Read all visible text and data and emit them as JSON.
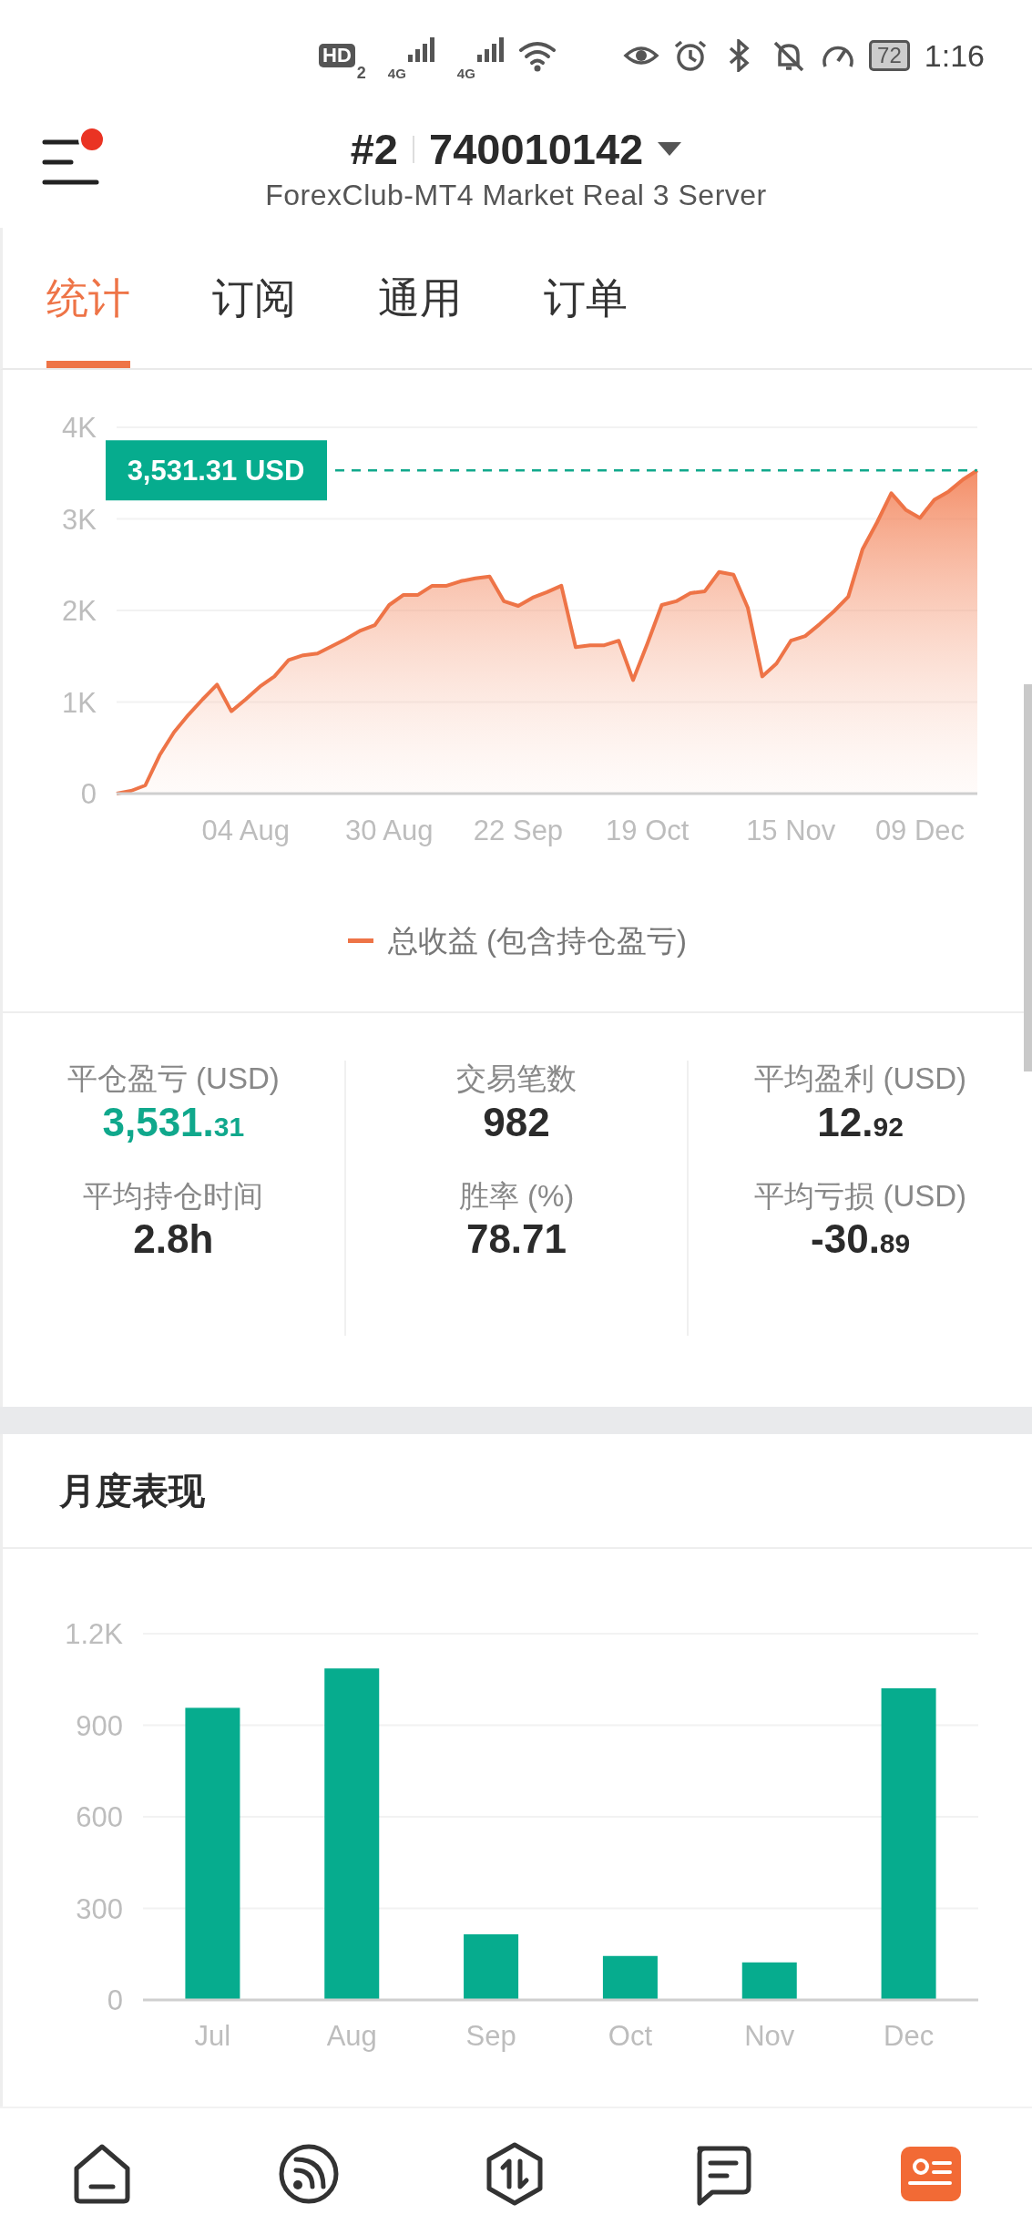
{
  "status_bar": {
    "hd": "HD",
    "sim": "2",
    "networks": [
      "4G",
      "4G"
    ],
    "battery": "72",
    "time": "1:16"
  },
  "header": {
    "account_index": "#2",
    "account_number": "740010142",
    "server": "ForexClub-MT4 Market Real 3 Server",
    "has_notification": true
  },
  "tabs": [
    {
      "label": "统计",
      "selected": true
    },
    {
      "label": "订阅",
      "selected": false
    },
    {
      "label": "通用",
      "selected": false
    },
    {
      "label": "订单",
      "selected": false
    }
  ],
  "equity_chart": {
    "current_value_label": "3,531.31 USD",
    "chart_data": {
      "type": "area",
      "grid": true,
      "categories": [
        null,
        null,
        null,
        null,
        null,
        null,
        null,
        null,
        null,
        "04 Aug",
        null,
        null,
        null,
        null,
        null,
        null,
        null,
        null,
        null,
        "30 Aug",
        null,
        null,
        null,
        null,
        null,
        null,
        null,
        null,
        "22 Sep",
        null,
        null,
        null,
        null,
        null,
        null,
        null,
        null,
        "19 Oct",
        null,
        null,
        null,
        null,
        null,
        null,
        null,
        null,
        null,
        "15 Nov",
        null,
        null,
        null,
        null,
        null,
        null,
        null,
        null,
        "09 Dec",
        null,
        null,
        null,
        null
      ],
      "series": [
        {
          "name": "总收益 (包含持仓盈亏)",
          "color": "#ee7447",
          "values": [
            0,
            30,
            90,
            420,
            670,
            860,
            1030,
            1190,
            900,
            1030,
            1170,
            1280,
            1460,
            1510,
            1530,
            1610,
            1690,
            1780,
            1840,
            2060,
            2170,
            2170,
            2270,
            2270,
            2320,
            2350,
            2370,
            2100,
            2050,
            2140,
            2200,
            2270,
            1600,
            1620,
            1620,
            1670,
            1240,
            1640,
            2060,
            2100,
            2190,
            2210,
            2420,
            2390,
            2030,
            1280,
            1420,
            1670,
            1720,
            1850,
            1990,
            2150,
            2670,
            2960,
            3280,
            3100,
            3010,
            3210,
            3300,
            3430,
            3530
          ]
        }
      ],
      "ylim": [
        0,
        4000
      ],
      "yticks": [
        {
          "value": 0,
          "label": "0"
        },
        {
          "value": 1000,
          "label": "1K"
        },
        {
          "value": 2000,
          "label": "2K"
        },
        {
          "value": 3000,
          "label": "3K"
        },
        {
          "value": 4000,
          "label": "4K"
        }
      ]
    }
  },
  "stats": [
    {
      "label": "平仓盈亏 (USD)",
      "value": "3,531.",
      "decimals": "31",
      "kind": "positive"
    },
    {
      "label": "交易笔数",
      "value": "982",
      "kind": "neutral"
    },
    {
      "label": "平均盈利 (USD)",
      "value": "12.",
      "decimals": "92",
      "kind": "neutral"
    },
    {
      "label": "平均持仓时间",
      "value": "2.8h",
      "kind": "neutral"
    },
    {
      "label": "胜率 (%)",
      "value": "78.71",
      "kind": "neutral"
    },
    {
      "label": "平均亏损 (USD)",
      "value": "-30.",
      "decimals": "89",
      "kind": "neutral"
    }
  ],
  "monthly": {
    "title": "月度表现",
    "chart_data": {
      "type": "bar",
      "grid": true,
      "categories": [
        "Jul",
        "Aug",
        "Sep",
        "Oct",
        "Nov",
        "Dec"
      ],
      "series": [
        {
          "color": "#06ac8e",
          "values": [
            957,
            1086,
            215,
            144,
            123,
            1021
          ]
        }
      ],
      "ylim": [
        0,
        1200
      ],
      "yticks": [
        {
          "value": 0,
          "label": "0"
        },
        {
          "value": 300,
          "label": "300"
        },
        {
          "value": 600,
          "label": "600"
        },
        {
          "value": 900,
          "label": "900"
        },
        {
          "value": 1200,
          "label": "1.2K"
        }
      ]
    }
  },
  "bottom_nav": [
    {
      "kind": "home",
      "selected": false
    },
    {
      "kind": "feed",
      "selected": false
    },
    {
      "kind": "trade",
      "selected": false
    },
    {
      "kind": "messages",
      "selected": false
    },
    {
      "kind": "account",
      "selected": true
    }
  ]
}
